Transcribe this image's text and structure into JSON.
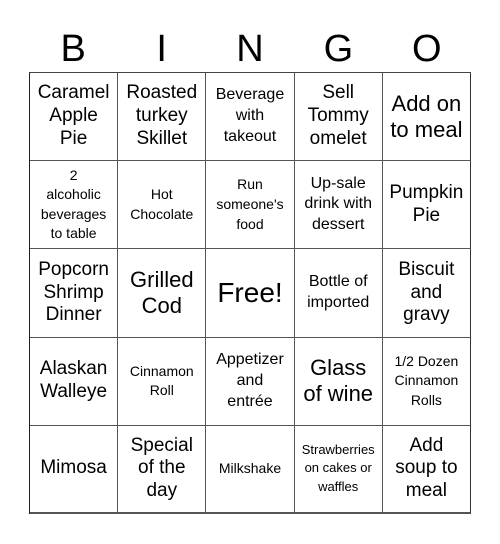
{
  "header": {
    "letters": [
      "B",
      "I",
      "N",
      "G",
      "O"
    ]
  },
  "board": {
    "cells": [
      {
        "text": "Caramel\nApple\nPie",
        "size": "s-m"
      },
      {
        "text": "Roasted\nturkey\nSkillet",
        "size": "s-m"
      },
      {
        "text": "Beverage\nwith\ntakeout",
        "size": "s-sm"
      },
      {
        "text": "Sell\nTommy\nomelet",
        "size": "s-m"
      },
      {
        "text": "Add on\nto meal",
        "size": "s-l"
      },
      {
        "text": "2\nalcoholic\nbeverages\nto table",
        "size": "s-s"
      },
      {
        "text": "Hot\nChocolate",
        "size": "s-s"
      },
      {
        "text": "Run\nsomeone's\nfood",
        "size": "s-s"
      },
      {
        "text": "Up-sale\ndrink with\ndessert",
        "size": "s-sm"
      },
      {
        "text": "Pumpkin\nPie",
        "size": "s-m"
      },
      {
        "text": "Popcorn\nShrimp\nDinner",
        "size": "s-m"
      },
      {
        "text": "Grilled\nCod",
        "size": "s-l"
      },
      {
        "text": "Free!",
        "size": "s-xl"
      },
      {
        "text": "Bottle of\nimported",
        "size": "s-sm"
      },
      {
        "text": "Biscuit\nand\ngravy",
        "size": "s-m"
      },
      {
        "text": "Alaskan\nWalleye",
        "size": "s-m"
      },
      {
        "text": "Cinnamon\nRoll",
        "size": "s-s"
      },
      {
        "text": "Appetizer\nand\nentrée",
        "size": "s-sm"
      },
      {
        "text": "Glass\nof wine",
        "size": "s-l"
      },
      {
        "text": "1/2 Dozen\nCinnamon\nRolls",
        "size": "s-s"
      },
      {
        "text": "Mimosa",
        "size": "s-m"
      },
      {
        "text": "Special\nof the\nday",
        "size": "s-m"
      },
      {
        "text": "Milkshake",
        "size": "s-s"
      },
      {
        "text": "Strawberries\non cakes or\nwaffles",
        "size": "s-xs"
      },
      {
        "text": "Add\nsoup to\nmeal",
        "size": "s-m"
      }
    ]
  }
}
